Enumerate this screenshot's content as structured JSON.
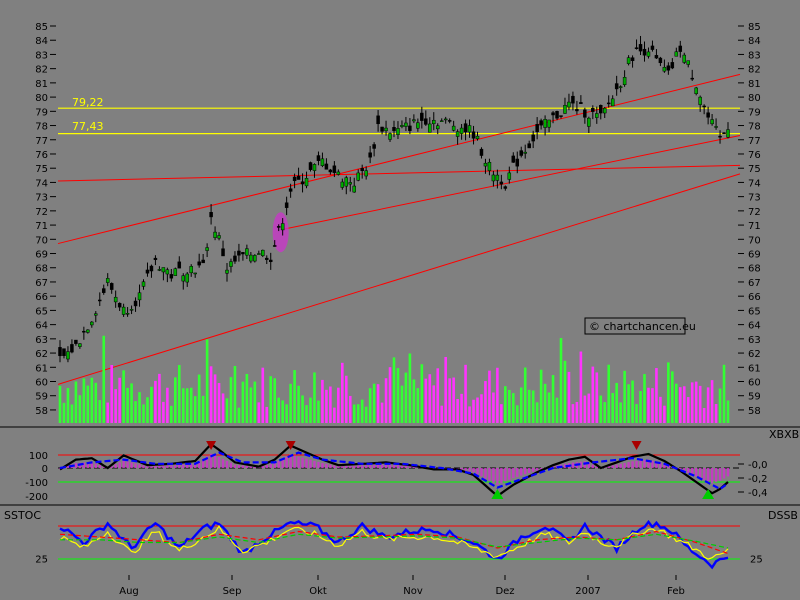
{
  "chart_data": [
    {
      "type": "candlestick",
      "title": "",
      "ylim": [
        56.5,
        85.5
      ],
      "y_ticks": [
        58,
        59,
        60,
        61,
        62,
        63,
        64,
        65,
        66,
        67,
        68,
        69,
        70,
        71,
        72,
        73,
        74,
        75,
        76,
        77,
        78,
        79,
        80,
        81,
        82,
        83,
        84,
        85
      ],
      "x_labels": [
        "Aug",
        "Sep",
        "Okt",
        "Nov",
        "Dez",
        "2007",
        "Feb"
      ],
      "horizontal_levels": [
        {
          "label": "79,22",
          "value": 79.22,
          "color": "#ffff00"
        },
        {
          "label": "77,43",
          "value": 77.43,
          "color": "#ffff00"
        }
      ],
      "trend_lines": [
        {
          "from": [
            0,
            69.7
          ],
          "to": [
            166,
            81.6
          ],
          "color": "#ff0000"
        },
        {
          "from": [
            0,
            74.1
          ],
          "to": [
            166,
            75.2
          ],
          "color": "#ff0000"
        },
        {
          "from": [
            56,
            70.7
          ],
          "to": [
            166,
            77.3
          ],
          "color": "#ff0000"
        },
        {
          "from": [
            0,
            59.8
          ],
          "to": [
            166,
            74.6
          ],
          "color": "#ff0000"
        }
      ],
      "price_keypoints": [
        [
          0,
          61.5
        ],
        [
          4,
          62.5
        ],
        [
          8,
          64.5
        ],
        [
          12,
          67
        ],
        [
          16,
          65
        ],
        [
          20,
          66
        ],
        [
          24,
          68.5
        ],
        [
          28,
          67.5
        ],
        [
          32,
          68
        ],
        [
          36,
          68
        ],
        [
          38,
          71.5
        ],
        [
          40,
          70
        ],
        [
          42,
          68
        ],
        [
          46,
          68.8
        ],
        [
          50,
          69.2
        ],
        [
          53,
          68.8
        ],
        [
          55,
          70.5
        ],
        [
          58,
          73.5
        ],
        [
          62,
          74.5
        ],
        [
          66,
          75.5
        ],
        [
          70,
          74.5
        ],
        [
          74,
          74
        ],
        [
          78,
          75.5
        ],
        [
          80,
          78
        ],
        [
          84,
          77.5
        ],
        [
          88,
          78
        ],
        [
          92,
          78.5
        ],
        [
          96,
          78.3
        ],
        [
          100,
          78
        ],
        [
          104,
          77.5
        ],
        [
          108,
          75
        ],
        [
          112,
          74
        ],
        [
          116,
          76
        ],
        [
          120,
          77.5
        ],
        [
          124,
          78.5
        ],
        [
          128,
          79.5
        ],
        [
          132,
          79
        ],
        [
          136,
          78.5
        ],
        [
          140,
          80.5
        ],
        [
          144,
          83
        ],
        [
          148,
          83.5
        ],
        [
          150,
          82.5
        ],
        [
          153,
          81.5
        ],
        [
          156,
          83.5
        ],
        [
          160,
          81
        ],
        [
          163,
          78.5
        ],
        [
          166,
          77
        ],
        [
          168,
          78
        ]
      ],
      "volume_ylim": [
        58,
        61
      ],
      "annotation": "© chartchancen.eu"
    },
    {
      "type": "line",
      "title": "XBXB",
      "ylim": [
        -0.45,
        0.05
      ],
      "y_ticks": [
        -0.0,
        -0.2,
        -0.4
      ],
      "y_tick_labels": [
        "-0,0",
        "-0,2",
        "-0,4"
      ],
      "left_ticks": [
        100,
        0,
        -100,
        -200
      ],
      "series": [
        {
          "name": "",
          "color": "#000000",
          "keypoints": [
            [
              0,
              -10
            ],
            [
              4,
              60
            ],
            [
              8,
              70
            ],
            [
              12,
              0
            ],
            [
              16,
              90
            ],
            [
              22,
              20
            ],
            [
              28,
              30
            ],
            [
              34,
              50
            ],
            [
              38,
              170
            ],
            [
              40,
              130
            ],
            [
              44,
              40
            ],
            [
              50,
              10
            ],
            [
              54,
              60
            ],
            [
              58,
              160
            ],
            [
              62,
              110
            ],
            [
              66,
              60
            ],
            [
              70,
              20
            ],
            [
              76,
              30
            ],
            [
              82,
              40
            ],
            [
              88,
              20
            ],
            [
              94,
              -10
            ],
            [
              100,
              -10
            ],
            [
              104,
              -50
            ],
            [
              108,
              -150
            ],
            [
              110,
              -200
            ],
            [
              114,
              -120
            ],
            [
              120,
              -30
            ],
            [
              124,
              20
            ],
            [
              128,
              60
            ],
            [
              132,
              80
            ],
            [
              136,
              0
            ],
            [
              140,
              40
            ],
            [
              144,
              80
            ],
            [
              148,
              100
            ],
            [
              152,
              50
            ],
            [
              156,
              -20
            ],
            [
              160,
              -100
            ],
            [
              164,
              -180
            ],
            [
              166,
              -150
            ],
            [
              168,
              -100
            ]
          ]
        },
        {
          "name": "",
          "color": "#0000ff",
          "dashed": true,
          "keypoints": [
            [
              0,
              0
            ],
            [
              8,
              40
            ],
            [
              16,
              60
            ],
            [
              24,
              30
            ],
            [
              34,
              30
            ],
            [
              40,
              110
            ],
            [
              46,
              40
            ],
            [
              54,
              40
            ],
            [
              60,
              110
            ],
            [
              66,
              60
            ],
            [
              76,
              30
            ],
            [
              86,
              30
            ],
            [
              96,
              0
            ],
            [
              104,
              -40
            ],
            [
              110,
              -140
            ],
            [
              116,
              -80
            ],
            [
              124,
              0
            ],
            [
              134,
              40
            ],
            [
              144,
              70
            ],
            [
              152,
              30
            ],
            [
              160,
              -60
            ],
            [
              166,
              -150
            ],
            [
              168,
              -110
            ]
          ]
        }
      ],
      "signals_down": [
        38,
        58,
        145
      ],
      "signals_up": [
        110,
        163
      ]
    },
    {
      "type": "line",
      "title": "SSTOC",
      "right_label": "DSSB",
      "y_ticks": [
        25
      ],
      "bands": [
        {
          "value": 80,
          "color": "#ff0000"
        },
        {
          "value": 20,
          "color": "#00ff00"
        }
      ],
      "series": [
        {
          "name": "",
          "color": "#0000ff",
          "keypoints": [
            [
              0,
              80
            ],
            [
              6,
              50
            ],
            [
              12,
              85
            ],
            [
              18,
              40
            ],
            [
              24,
              85
            ],
            [
              30,
              40
            ],
            [
              36,
              75
            ],
            [
              40,
              85
            ],
            [
              46,
              30
            ],
            [
              52,
              60
            ],
            [
              58,
              85
            ],
            [
              64,
              80
            ],
            [
              70,
              50
            ],
            [
              76,
              80
            ],
            [
              82,
              60
            ],
            [
              88,
              70
            ],
            [
              94,
              75
            ],
            [
              100,
              60
            ],
            [
              104,
              50
            ],
            [
              110,
              20
            ],
            [
              116,
              60
            ],
            [
              122,
              80
            ],
            [
              128,
              50
            ],
            [
              132,
              80
            ],
            [
              136,
              60
            ],
            [
              140,
              40
            ],
            [
              146,
              80
            ],
            [
              150,
              85
            ],
            [
              154,
              70
            ],
            [
              158,
              40
            ],
            [
              164,
              10
            ],
            [
              168,
              25
            ]
          ]
        },
        {
          "name": "",
          "color": "#ffff00",
          "keypoints": [
            [
              0,
              60
            ],
            [
              6,
              40
            ],
            [
              12,
              70
            ],
            [
              18,
              30
            ],
            [
              24,
              70
            ],
            [
              30,
              35
            ],
            [
              36,
              60
            ],
            [
              40,
              75
            ],
            [
              46,
              35
            ],
            [
              52,
              50
            ],
            [
              58,
              75
            ],
            [
              64,
              65
            ],
            [
              70,
              45
            ],
            [
              76,
              70
            ],
            [
              82,
              55
            ],
            [
              88,
              60
            ],
            [
              94,
              60
            ],
            [
              100,
              50
            ],
            [
              104,
              40
            ],
            [
              110,
              25
            ],
            [
              116,
              45
            ],
            [
              122,
              65
            ],
            [
              128,
              50
            ],
            [
              132,
              70
            ],
            [
              136,
              50
            ],
            [
              140,
              45
            ],
            [
              146,
              70
            ],
            [
              150,
              75
            ],
            [
              154,
              60
            ],
            [
              158,
              45
            ],
            [
              164,
              20
            ],
            [
              168,
              35
            ]
          ]
        },
        {
          "name": "",
          "color": "#ff0000",
          "dashed": true,
          "keypoints": [
            [
              0,
              65
            ],
            [
              10,
              60
            ],
            [
              20,
              55
            ],
            [
              30,
              50
            ],
            [
              40,
              65
            ],
            [
              50,
              55
            ],
            [
              60,
              70
            ],
            [
              70,
              60
            ],
            [
              80,
              62
            ],
            [
              90,
              65
            ],
            [
              100,
              60
            ],
            [
              110,
              40
            ],
            [
              120,
              55
            ],
            [
              130,
              60
            ],
            [
              140,
              55
            ],
            [
              150,
              70
            ],
            [
              160,
              50
            ],
            [
              168,
              30
            ]
          ]
        },
        {
          "name": "",
          "color": "#00cc00",
          "dashed": true,
          "keypoints": [
            [
              0,
              55
            ],
            [
              10,
              55
            ],
            [
              20,
              50
            ],
            [
              30,
              50
            ],
            [
              40,
              60
            ],
            [
              50,
              50
            ],
            [
              60,
              65
            ],
            [
              70,
              58
            ],
            [
              80,
              60
            ],
            [
              90,
              62
            ],
            [
              100,
              58
            ],
            [
              110,
              42
            ],
            [
              120,
              50
            ],
            [
              130,
              58
            ],
            [
              140,
              55
            ],
            [
              150,
              65
            ],
            [
              160,
              52
            ],
            [
              168,
              40
            ]
          ]
        }
      ]
    }
  ]
}
